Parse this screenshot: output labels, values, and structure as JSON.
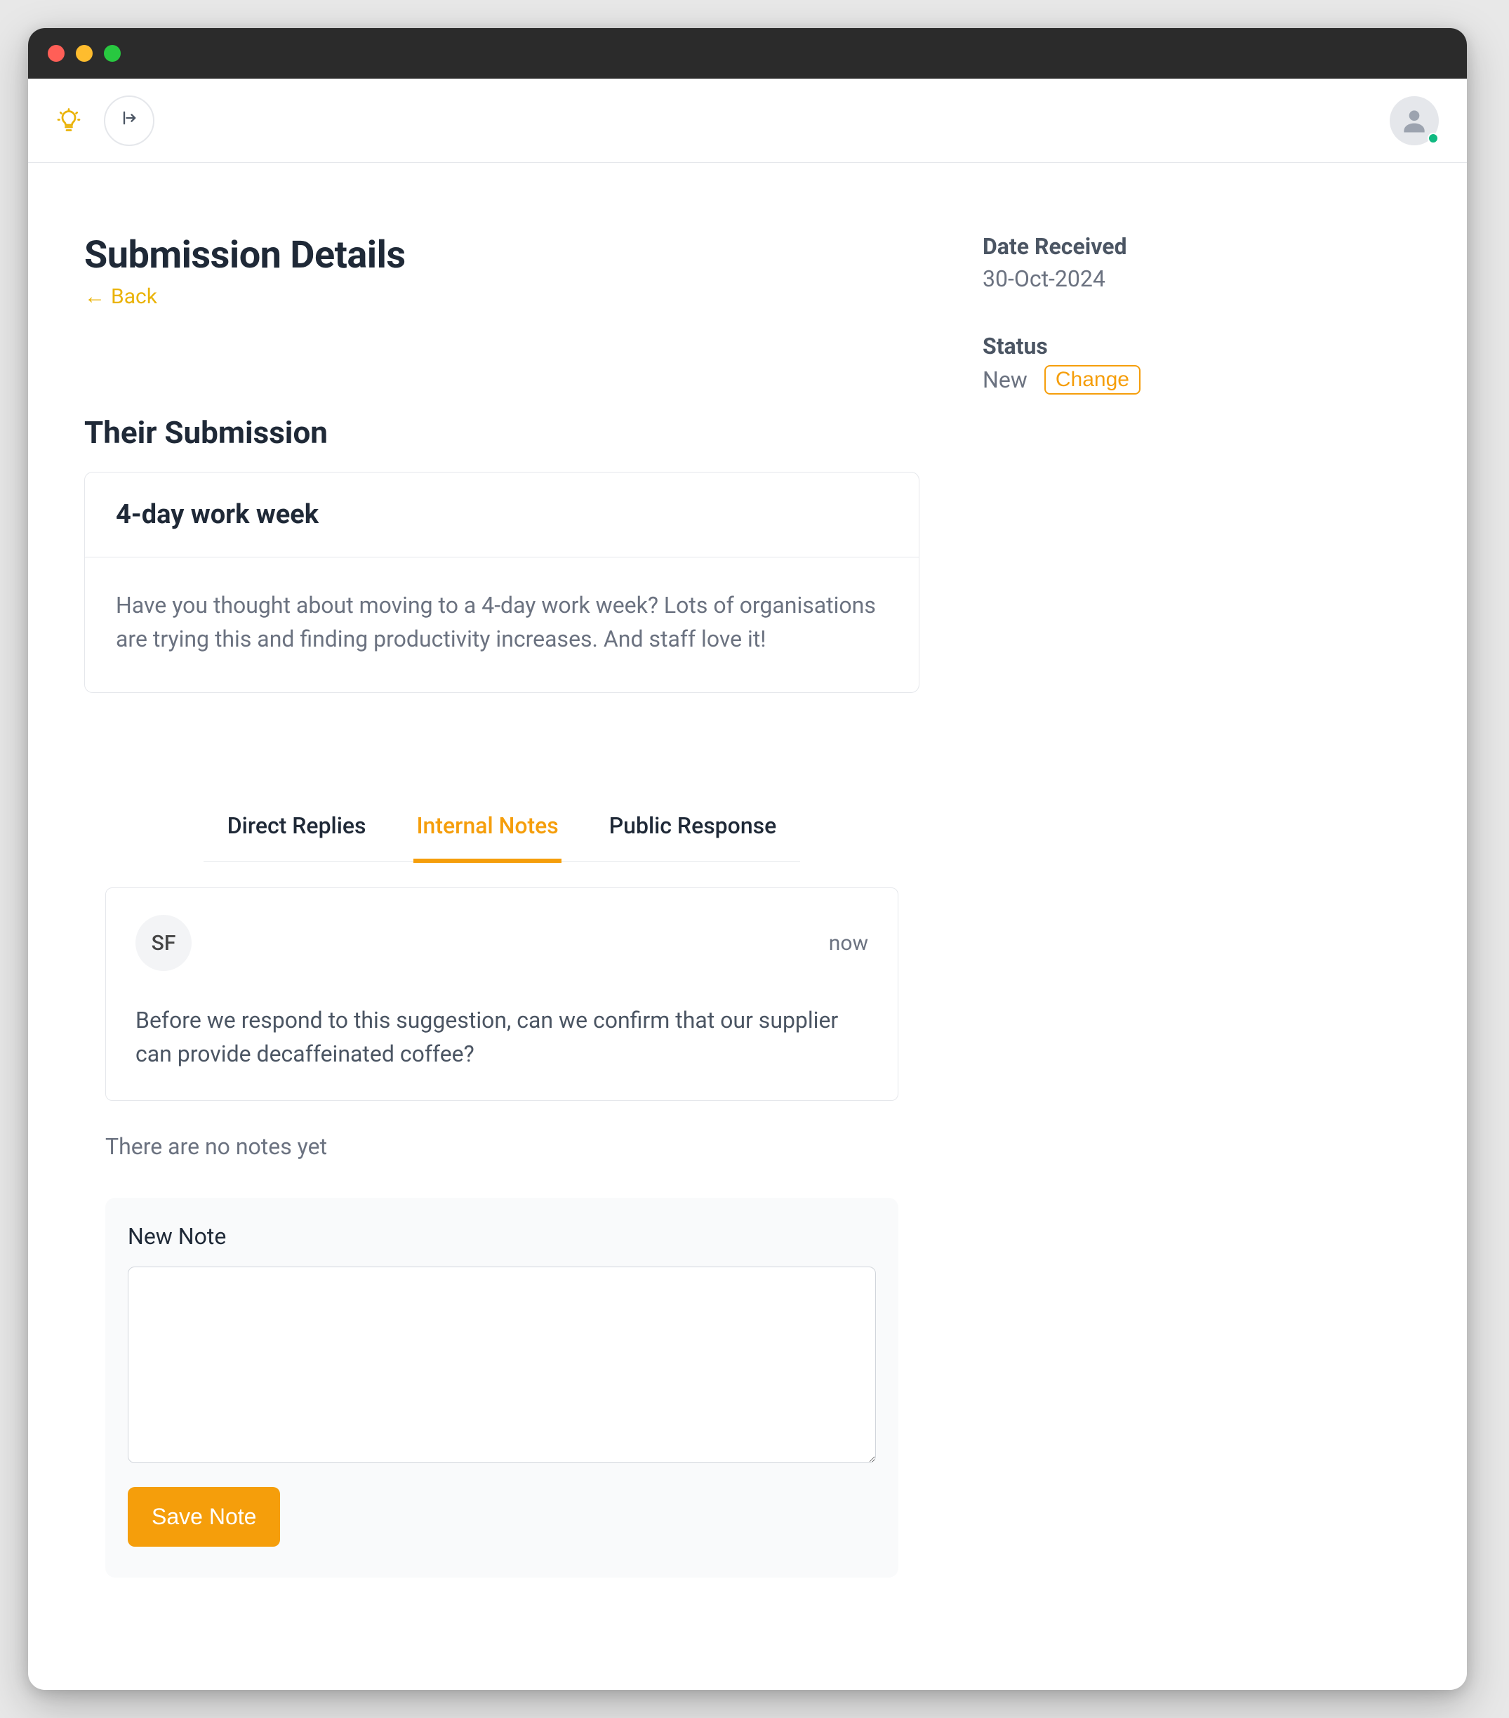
{
  "header": {
    "page_title": "Submission Details",
    "back_label": "Back"
  },
  "side": {
    "date_label": "Date Received",
    "date_value": "30-Oct-2024",
    "status_label": "Status",
    "status_value": "New",
    "change_label": "Change"
  },
  "submission": {
    "section_title": "Their Submission",
    "title": "4-day work week",
    "body": "Have you thought about moving to a 4-day work week? Lots of organisations are trying this and finding productivity increases. And staff love it!"
  },
  "tabs": {
    "direct_replies": "Direct Replies",
    "internal_notes": "Internal Notes",
    "public_response": "Public Response"
  },
  "note": {
    "author_initials": "SF",
    "time": "now",
    "body": "Before we respond to this suggestion, can we confirm that our supplier can provide decaffeinated coffee?"
  },
  "empty_notes": "There are no notes yet",
  "new_note": {
    "label": "New Note",
    "save_label": "Save Note"
  }
}
